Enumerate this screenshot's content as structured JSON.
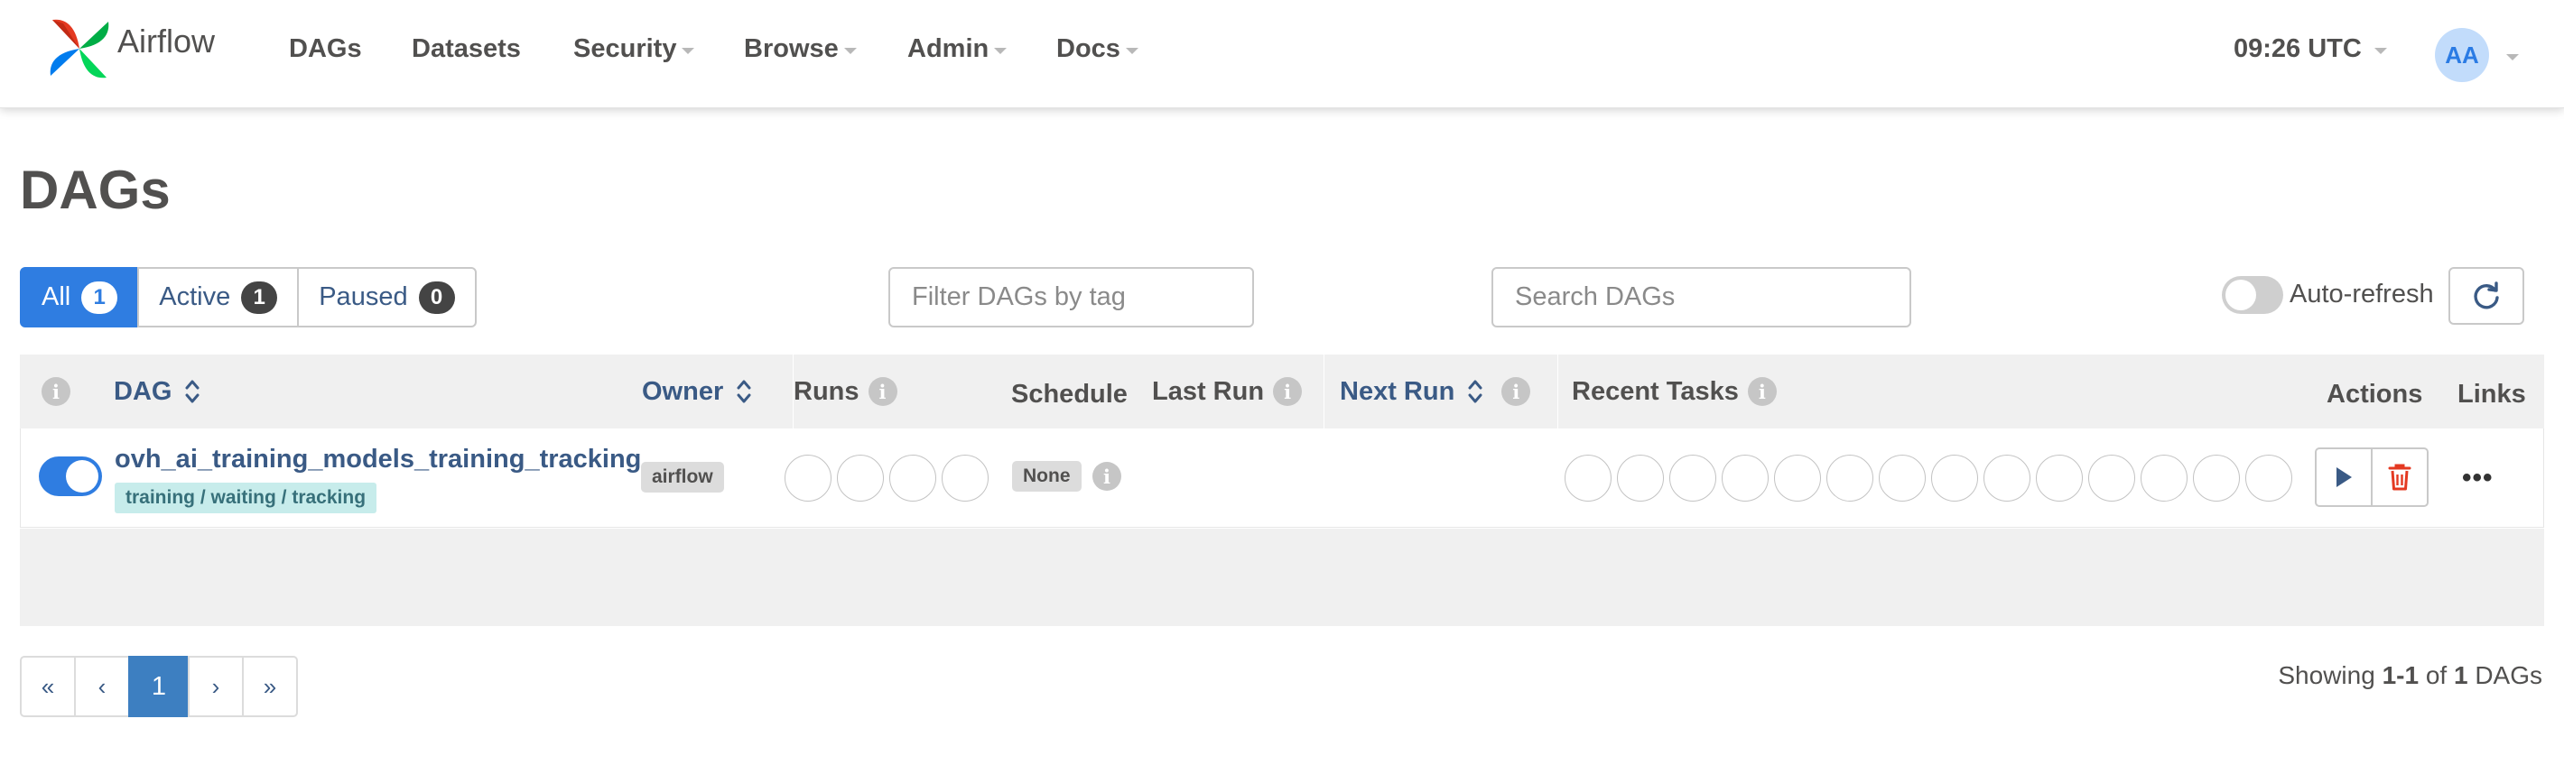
{
  "app": {
    "name": "Airflow"
  },
  "nav": {
    "items": [
      {
        "label": "DAGs",
        "dropdown": false
      },
      {
        "label": "Datasets",
        "dropdown": false
      },
      {
        "label": "Security",
        "dropdown": true
      },
      {
        "label": "Browse",
        "dropdown": true
      },
      {
        "label": "Admin",
        "dropdown": true
      },
      {
        "label": "Docs",
        "dropdown": true
      }
    ],
    "clock": "09:26 UTC",
    "avatar_initials": "AA"
  },
  "page": {
    "title": "DAGs"
  },
  "filters": {
    "all": {
      "label": "All",
      "count": "1"
    },
    "active": {
      "label": "Active",
      "count": "1"
    },
    "paused": {
      "label": "Paused",
      "count": "0"
    },
    "tag_placeholder": "Filter DAGs by tag",
    "search_placeholder": "Search DAGs",
    "auto_refresh_label": "Auto-refresh"
  },
  "table": {
    "headers": {
      "dag": "DAG",
      "owner": "Owner",
      "runs": "Runs",
      "schedule": "Schedule",
      "last_run": "Last Run",
      "next_run": "Next Run",
      "recent_tasks": "Recent Tasks",
      "actions": "Actions",
      "links": "Links"
    },
    "rows": [
      {
        "enabled": true,
        "dag_id": "ovh_ai_training_models_training_tracking",
        "tag": "training / waiting / tracking",
        "owner": "airflow",
        "schedule": "None",
        "last_run": "",
        "next_run": "",
        "run_circles": 4,
        "task_circles": 14
      }
    ]
  },
  "pagination": {
    "first": "«",
    "prev": "‹",
    "current": "1",
    "next": "›",
    "last": "»"
  },
  "summary": {
    "prefix": "Showing",
    "range": "1-1",
    "of": "of",
    "total": "1",
    "suffix": "DAGs"
  },
  "colors": {
    "primary": "#2f7de1",
    "link": "#3a5a85",
    "tag_bg": "#c7eceb",
    "delete": "#e43921"
  }
}
